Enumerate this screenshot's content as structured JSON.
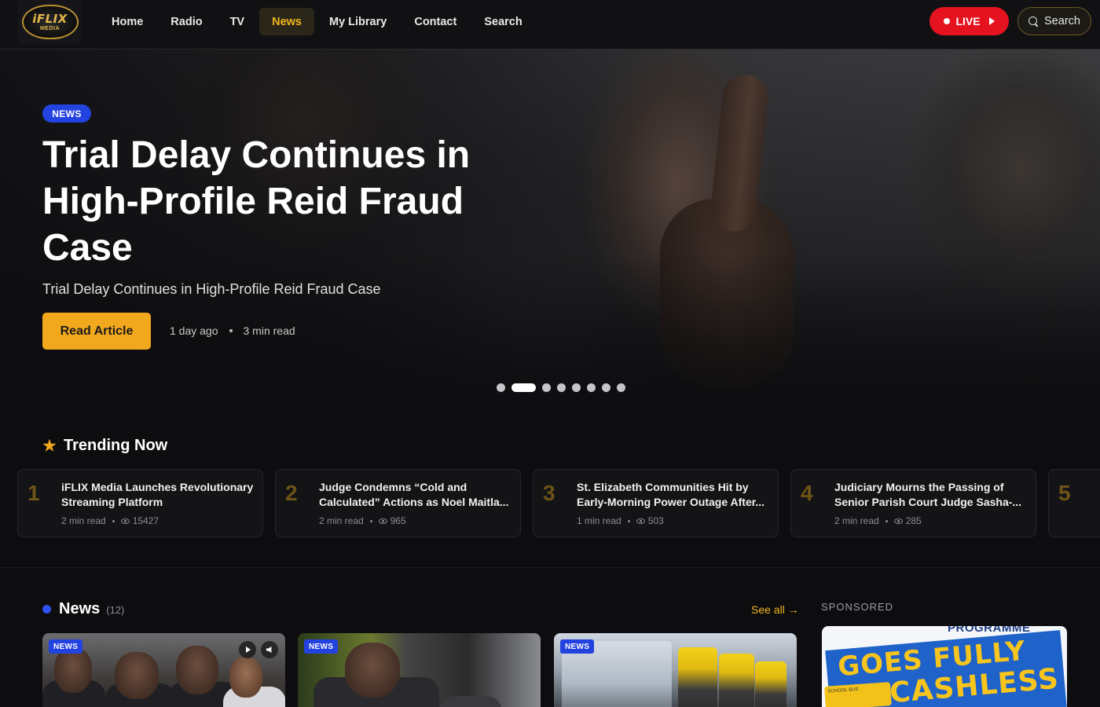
{
  "logo": {
    "word": "iFLIX",
    "sub": "MEDIA"
  },
  "nav": {
    "links": [
      "Home",
      "Radio",
      "TV",
      "News",
      "My Library",
      "Contact",
      "Search"
    ],
    "active": "News",
    "live_label": "LIVE",
    "search_label": "Search"
  },
  "hero": {
    "badge": "NEWS",
    "title": "Trial Delay Continues in High-Profile Reid Fraud Case",
    "subtitle": "Trial Delay Continues in High-Profile Reid Fraud Case",
    "cta": "Read Article",
    "time_ago": "1 day ago",
    "read_time": "3 min read",
    "slide_count": 8,
    "active_slide": 2
  },
  "trending": {
    "title": "Trending Now",
    "items": [
      {
        "rank": "1",
        "title": "iFLIX Media Launches Revolutionary Streaming Platform",
        "read": "2 min read",
        "views": "15427"
      },
      {
        "rank": "2",
        "title": "Judge Condemns “Cold and Calculated” Actions as Noel Maitla...",
        "read": "2 min read",
        "views": "965"
      },
      {
        "rank": "3",
        "title": "St. Elizabeth Communities Hit by Early-Morning Power Outage After...",
        "read": "1 min read",
        "views": "503"
      },
      {
        "rank": "4",
        "title": "Judiciary Mourns the Passing of Senior Parish Court Judge Sasha-...",
        "read": "2 min read",
        "views": "285"
      },
      {
        "rank": "5",
        "title": "",
        "read": "",
        "views": ""
      }
    ]
  },
  "news_section": {
    "title": "News",
    "count": "(12)",
    "see_all": "See all →",
    "cards": [
      {
        "badge": "NEWS"
      },
      {
        "badge": "NEWS"
      },
      {
        "badge": "NEWS"
      }
    ]
  },
  "sponsored": {
    "label": "SPONSORED",
    "ad_top": "PROGRAMME",
    "ad_line1": "GOES FULLY",
    "ad_line2": "CASHLESS",
    "ad_bus": "SCHOOL BUS"
  },
  "colors": {
    "accent": "#f2a81d",
    "live": "#e5131f",
    "badge": "#2343e0"
  }
}
